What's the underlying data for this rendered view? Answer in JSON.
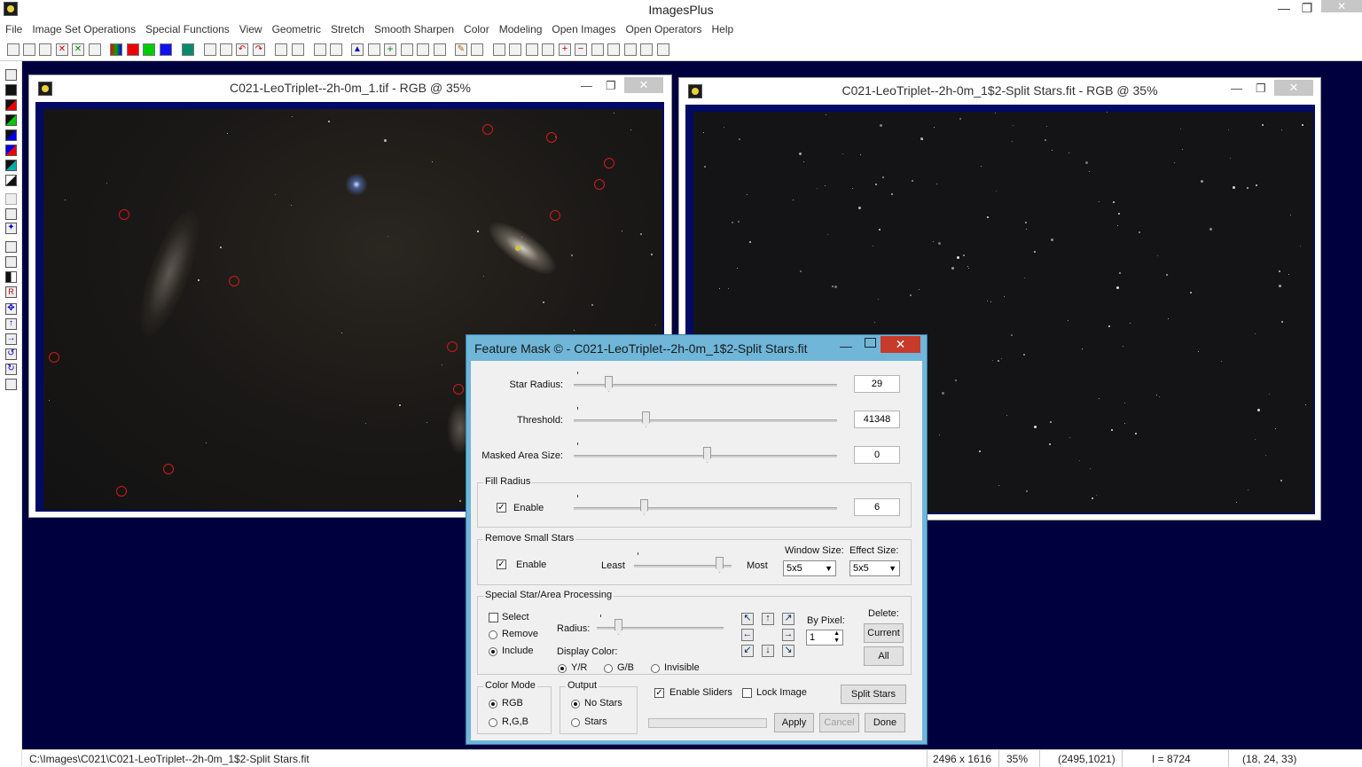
{
  "app": {
    "title": "ImagesPlus"
  },
  "menu": [
    "File",
    "Image Set Operations",
    "Special Functions",
    "View",
    "Geometric",
    "Stretch",
    "Smooth Sharpen",
    "Color",
    "Modeling",
    "Open Images",
    "Open Operators",
    "Help"
  ],
  "window1": {
    "title": "C021-LeoTriplet--2h-0m_1.tif - RGB @ 35%"
  },
  "window2": {
    "title": "C021-LeoTriplet--2h-0m_1$2-Split Stars.fit - RGB @ 35%"
  },
  "dialog": {
    "title": "Feature Mask © - C021-LeoTriplet--2h-0m_1$2-Split Stars.fit",
    "star_radius": {
      "label": "Star Radius:",
      "value": "29"
    },
    "threshold": {
      "label": "Threshold:",
      "value": "41348"
    },
    "masked_area": {
      "label": "Masked Area Size:",
      "value": "0"
    },
    "fill_radius": {
      "group": "Fill Radius",
      "enable": "Enable",
      "value": "6"
    },
    "remove_small": {
      "group": "Remove Small Stars",
      "enable": "Enable",
      "least": "Least",
      "most": "Most",
      "window_size_label": "Window Size:",
      "window_size": "5x5",
      "effect_size_label": "Effect Size:",
      "effect_size": "5x5"
    },
    "special": {
      "group": "Special Star/Area Processing",
      "select": "Select",
      "remove": "Remove",
      "include": "Include",
      "radius": "Radius:",
      "display_color": "Display Color:",
      "yr": "Y/R",
      "gb": "G/B",
      "invisible": "Invisible",
      "by_pixel": "By Pixel:",
      "pixel_value": "1",
      "delete": "Delete:",
      "current": "Current",
      "all": "All"
    },
    "color_mode": {
      "group": "Color Mode",
      "rgb": "RGB",
      "r_g_b": "R,G,B"
    },
    "output": {
      "group": "Output",
      "no_stars": "No Stars",
      "stars": "Stars"
    },
    "enable_sliders": "Enable Sliders",
    "lock_image": "Lock Image",
    "split_stars": "Split Stars",
    "apply": "Apply",
    "cancel": "Cancel",
    "done": "Done"
  },
  "status": {
    "path": "C:\\Images\\C021\\C021-LeoTriplet--2h-0m_1$2-Split Stars.fit",
    "dims": "2496 x 1616",
    "zoom": "35%",
    "coords": "(2495,1021)",
    "intensity": "I = 8724",
    "rgb": "(18, 24, 33)"
  },
  "colors": {
    "workspace": "#00003e",
    "frame": "#020a63",
    "dialog_border": "#6fb6d9",
    "close_red": "#c83a2a",
    "ring": "#d11a1a"
  }
}
